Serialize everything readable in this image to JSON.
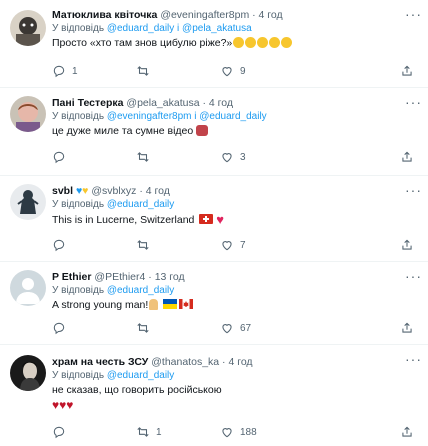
{
  "tweets": [
    {
      "name": "Матюклива квіточка",
      "handle": "@eveningafter8pm",
      "dot": "·",
      "time": "4 год",
      "reply_prefix": "У відповідь",
      "reply_to": "@eduard_daily і @pela_akatusa",
      "text": "Просто «хто там знов цибулю ріже?»",
      "counts": {
        "reply": "1",
        "retweet": "",
        "like": "9"
      }
    },
    {
      "name": "Пані Тестерка",
      "handle": "@pela_akatusa",
      "dot": "·",
      "time": "4 год",
      "reply_prefix": "У відповідь",
      "reply_to": "@eveningafter8pm і @eduard_daily",
      "text": "це дуже миле та сумне відео",
      "counts": {
        "reply": "",
        "retweet": "",
        "like": "3"
      }
    },
    {
      "name": "svbl",
      "handle": "@svblxyz",
      "dot": "·",
      "time": "4 год",
      "reply_prefix": "У відповідь",
      "reply_to": "@eduard_daily",
      "text": "This is in Lucerne, Switzerland",
      "counts": {
        "reply": "",
        "retweet": "",
        "like": "7"
      }
    },
    {
      "name": "P Ethier",
      "handle": "@PEthier4",
      "dot": "·",
      "time": "13 год",
      "reply_prefix": "У відповідь",
      "reply_to": "@eduard_daily",
      "text": "A strong young man!",
      "counts": {
        "reply": "",
        "retweet": "",
        "like": "67"
      }
    },
    {
      "name": "храм на честь ЗСУ",
      "handle": "@thanatos_ka",
      "dot": "·",
      "time": "4 год",
      "reply_prefix": "У відповідь",
      "reply_to": "@eduard_daily",
      "text": "не сказав, що говорить російською",
      "counts": {
        "reply": "",
        "retweet": "1",
        "like": "188"
      }
    }
  ],
  "icons": [
    "more-icon",
    "reply-icon",
    "retweet-icon",
    "like-icon",
    "share-icon"
  ],
  "colors": {
    "link": "#1d9bf0",
    "secondary": "#536471",
    "text": "#0f1419"
  }
}
